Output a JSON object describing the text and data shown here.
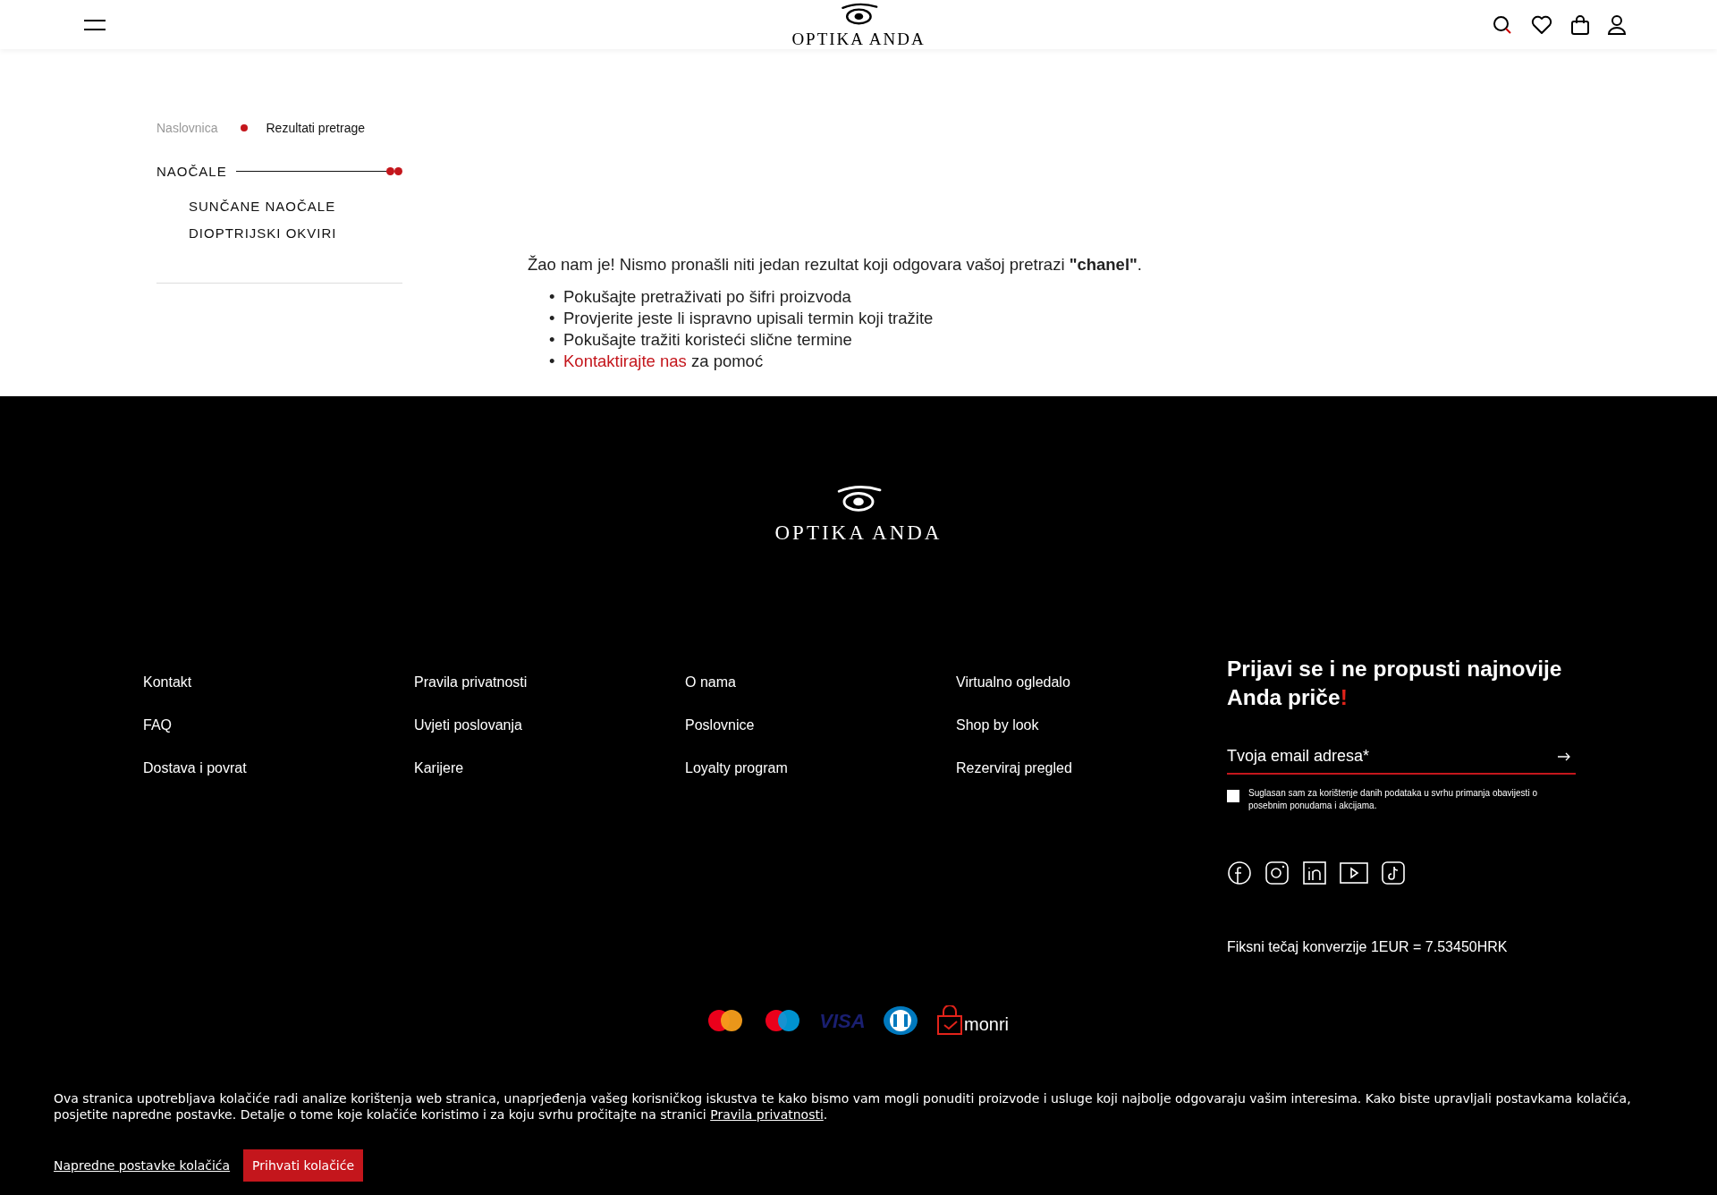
{
  "header": {
    "logo": "OPTIKA ANDA"
  },
  "breadcrumbs": [
    {
      "label": "Naslovnica",
      "current": false
    },
    {
      "label": "Rezultati pretrage",
      "current": true
    }
  ],
  "sidebar": {
    "items": [
      {
        "label": "NAOČALE",
        "expanded": true,
        "children": [
          {
            "label": "SUNČANE NAOČALE"
          },
          {
            "label": "DIOPTRIJSKI OKVIRI"
          }
        ]
      }
    ]
  },
  "message": {
    "text": "Žao nam je! Nismo pronašli niti jedan rezultat koji odgovara vašoj pretrazi **\"chanel\"**.",
    "tips": [
      {
        "kind": "text",
        "marker": "•",
        "text": "Pokušajte pretraživati po šifri proizvoda"
      },
      {
        "kind": "text",
        "marker": "•",
        "text": "Provjerite jeste li ispravno upisali termin koji tražite"
      },
      {
        "kind": "text",
        "marker": "•",
        "text": "Pokušajte tražiti koristeći slične termine"
      },
      {
        "kind": "link",
        "marker": "•",
        "link": "Kontaktirajte nas",
        "text": "za pomoć"
      }
    ]
  },
  "footer": {
    "logo": "OPTIKA ANDA",
    "columns": [
      [
        "Kontakt",
        "FAQ",
        "Dostava i povrat"
      ],
      [
        "Pravila privatnosti",
        "Uvjeti poslovanja",
        "Karijere"
      ],
      [
        "O nama",
        "Poslovnice",
        "Loyalty program"
      ],
      [
        "Virtualno ogledalo",
        "Shop by look",
        "Rezerviraj pregled"
      ]
    ],
    "newsletter": {
      "title": "Prijavi se i ne propusti najnovije Anda priče",
      "accent": "!",
      "placeholder": "Tvoja email adresa*",
      "consent": "Suglasan sam za korištenje danih podataka u svrhu primanja obavijesti o posebnim ponudama i akcijama.",
      "checked": false
    },
    "social": [
      {
        "kind": "facebook"
      },
      {
        "kind": "instagram"
      },
      {
        "kind": "linkedin"
      },
      {
        "kind": "youtube"
      },
      {
        "kind": "tiktok"
      }
    ],
    "rate": "Fiksni tečaj konverzije 1EUR = 7.53450HRK",
    "payments": [
      {
        "kind": "mastercard"
      },
      {
        "kind": "maestro"
      },
      {
        "kind": "visa",
        "label": "VISA"
      },
      {
        "kind": "diners"
      },
      {
        "kind": "monri",
        "label": "monri"
      }
    ]
  },
  "cookie": {
    "text": "Ova stranica upotrebljava kolačiće radi analize korištenja web stranica, unaprjeđenja vašeg korisničkog iskustva te kako bismo vam mogli ponuditi proizvode i usluge koji najbolje odgovaraju vašim interesima. Kako biste upravljali postavkama kolačića, posjetite napredne postavke. Detalje o tome koje kolačiće koristimo i za koju svrhu pročitajte na stranici",
    "link": "Pravila privatnosti",
    "end": ".",
    "settings": "Napredne postavke kolačića",
    "accept": "Prihvati kolačiće"
  }
}
